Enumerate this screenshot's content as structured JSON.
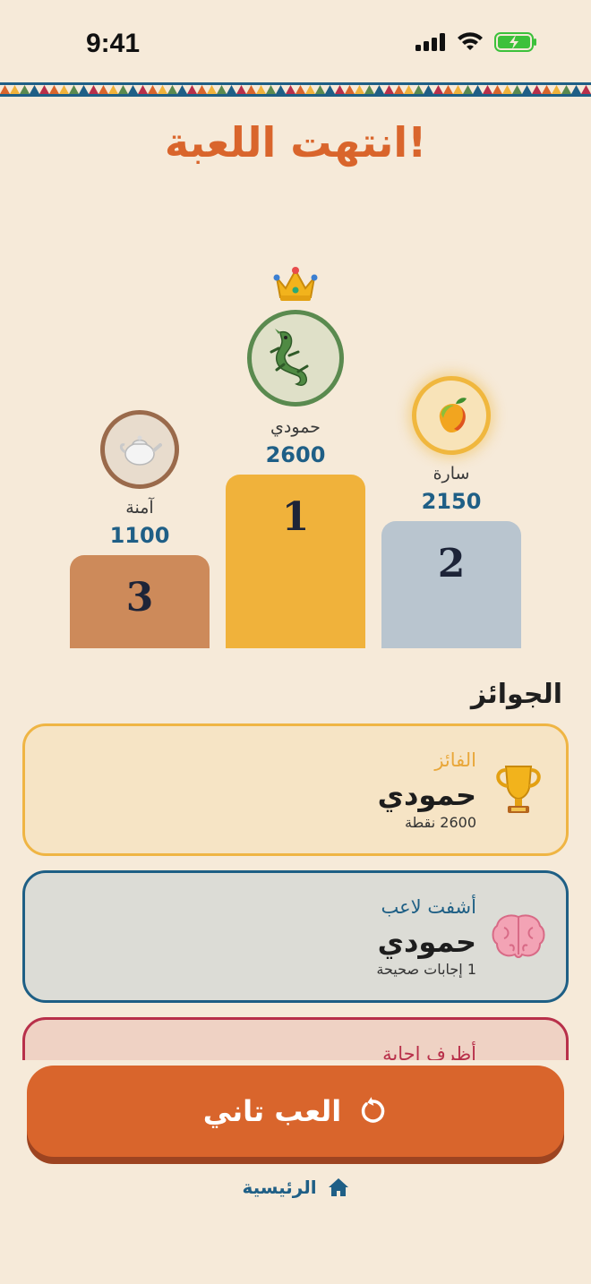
{
  "status_bar": {
    "time": "9:41"
  },
  "title": "انتهت اللعبة!",
  "podium": {
    "first": {
      "rank": "1",
      "name": "حمودي",
      "score": "2600",
      "avatar": "crocodile-icon"
    },
    "second": {
      "rank": "2",
      "name": "سارة",
      "score": "2150",
      "avatar": "mango-icon"
    },
    "third": {
      "rank": "3",
      "name": "آمنة",
      "score": "1100",
      "avatar": "teapot-icon"
    }
  },
  "awards": {
    "title": "الجوائز",
    "items": [
      {
        "label": "الفائز",
        "name": "حمودي",
        "detail": "2600 نقطة",
        "icon": "trophy-icon"
      },
      {
        "label": "أشفت لاعب",
        "name": "حمودي",
        "detail": "1 إجابات صحيحة",
        "icon": "brain-icon"
      },
      {
        "label": "أظرف اجابة",
        "icon": "partial"
      }
    ]
  },
  "play_again_label": "العب تاني",
  "home_label": "الرئيسية",
  "colors": {
    "background": "#f6ead9",
    "accent": "#d9652c",
    "blue": "#1f5f86",
    "gold": "#f0b23b",
    "silver": "#b9c5cf",
    "bronze": "#cd8a5a"
  }
}
